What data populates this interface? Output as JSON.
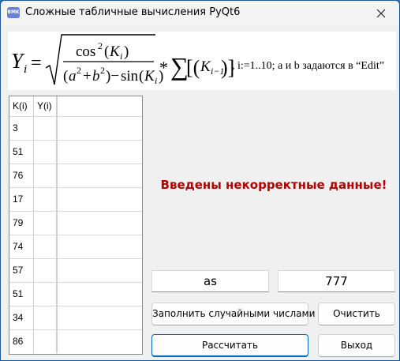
{
  "window": {
    "title": "Сложные табличные вычисления PyQt6",
    "icon_text": "BMK"
  },
  "formula": {
    "Y": "Y",
    "i": "i",
    "cos": "cos",
    "two": "2",
    "K": "K",
    "a": "a",
    "b": "b",
    "sin": "sin",
    "sum": "∑",
    "im1": "i−1",
    "mult": "*",
    "note": ", i:=1..10; a и b задаются в “Edit”"
  },
  "table": {
    "headers": [
      "K(i)",
      "Y(i)"
    ],
    "rows": [
      {
        "k": "3",
        "y": ""
      },
      {
        "k": "51",
        "y": ""
      },
      {
        "k": "76",
        "y": ""
      },
      {
        "k": "17",
        "y": ""
      },
      {
        "k": "79",
        "y": ""
      },
      {
        "k": "74",
        "y": ""
      },
      {
        "k": "57",
        "y": ""
      },
      {
        "k": "51",
        "y": ""
      },
      {
        "k": "34",
        "y": ""
      },
      {
        "k": "86",
        "y": ""
      }
    ]
  },
  "status": {
    "error_text": "Введены некорректные данные!",
    "error_color": "#b00000"
  },
  "inputs": {
    "a_value": "as",
    "b_value": "777"
  },
  "buttons": {
    "fill_random": "Заполнить случайными числами",
    "clear": "Очистить",
    "calculate": "Рассчитать",
    "exit": "Выход"
  },
  "icons": {
    "app": "app-icon",
    "close": "close-icon"
  }
}
